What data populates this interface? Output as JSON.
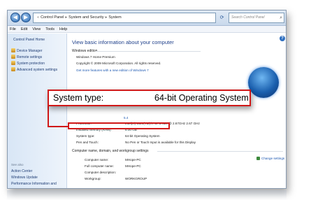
{
  "address_bar": {
    "crumbs": [
      "Control Panel",
      "System and Security",
      "System"
    ],
    "search_placeholder": "Search Control Panel"
  },
  "menu": [
    "File",
    "Edit",
    "View",
    "Tools",
    "Help"
  ],
  "sidebar": {
    "home": "Control Panel Home",
    "items": [
      {
        "label": "Device Manager"
      },
      {
        "label": "Remote settings"
      },
      {
        "label": "System protection"
      },
      {
        "label": "Advanced system settings"
      }
    ],
    "see_also": "See also",
    "see_also_items": [
      "Action Center",
      "Windows Update",
      "Performance Information and"
    ]
  },
  "main": {
    "heading": "View basic information about your computer",
    "edition_header": "Windows edition",
    "edition": "Windows 7 Home Premium",
    "copyright": "Copyright © 2009 Microsoft Corporation.  All rights reserved.",
    "more_features": "Get more features with a new edition of Windows 7",
    "rating_fragment": "5.4",
    "system_rows": [
      {
        "label": "Processor:",
        "value": "Intel(R) Core(TM) i7 CPU        920  @ 2.67GHz   2.67 GHz"
      },
      {
        "label": "Installed memory (RAM):",
        "value": "6.00 GB"
      },
      {
        "label": "System type:",
        "value": "64-bit Operating System"
      },
      {
        "label": "Pen and Touch:",
        "value": "No Pen or Touch Input is available for this Display"
      }
    ],
    "computer_header": "Computer name, domain, and workgroup settings",
    "computer_rows": [
      {
        "label": "Computer name:",
        "value": "MHope-PC"
      },
      {
        "label": "Full computer name:",
        "value": "MHope-PC"
      },
      {
        "label": "Computer description:",
        "value": ""
      },
      {
        "label": "Workgroup:",
        "value": "WORKGROUP"
      }
    ],
    "change_settings": "Change settings"
  },
  "callout": {
    "label": "System type:",
    "value": "64-bit Operating System"
  },
  "colors": {
    "highlight": "#d01818",
    "link": "#1a56b0",
    "heading": "#1e3f8a"
  }
}
